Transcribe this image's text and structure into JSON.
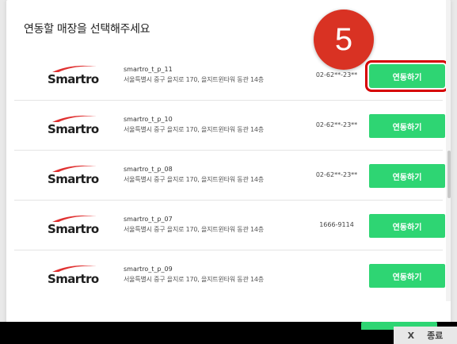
{
  "heading": "연동할 매장을 선택해주세요",
  "step_badge": "5",
  "logo_text": "Smartro",
  "link_label": "연동하기",
  "stores": [
    {
      "name": "smartro_t_p_11",
      "address": "서울특별시 중구 을지로 170, 을지트윈타워 동관 14층",
      "phone": "02-62**-23**",
      "highlight": true
    },
    {
      "name": "smartro_t_p_10",
      "address": "서울특별시 중구 을지로 170, 을지트윈타워 동관 14층",
      "phone": "02-62**-23**",
      "highlight": false
    },
    {
      "name": "smartro_t_p_08",
      "address": "서울특별시 중구 을지로 170, 을지트윈타워 동관 14층",
      "phone": "02-62**-23**",
      "highlight": false
    },
    {
      "name": "smartro_t_p_07",
      "address": "서울특별시 중구 을지로 170, 을지트윈타워 동관 14층",
      "phone": "1666-9114",
      "highlight": false
    },
    {
      "name": "smartro_t_p_09",
      "address": "서울특별시 중구 을지로 170, 을지트윈타워 동관 14층",
      "phone": "",
      "highlight": false
    }
  ],
  "close": {
    "icon": "X",
    "label": "종료"
  },
  "colors": {
    "green": "#2ed573",
    "highlight": "#d60000",
    "badge": "#d93223"
  }
}
